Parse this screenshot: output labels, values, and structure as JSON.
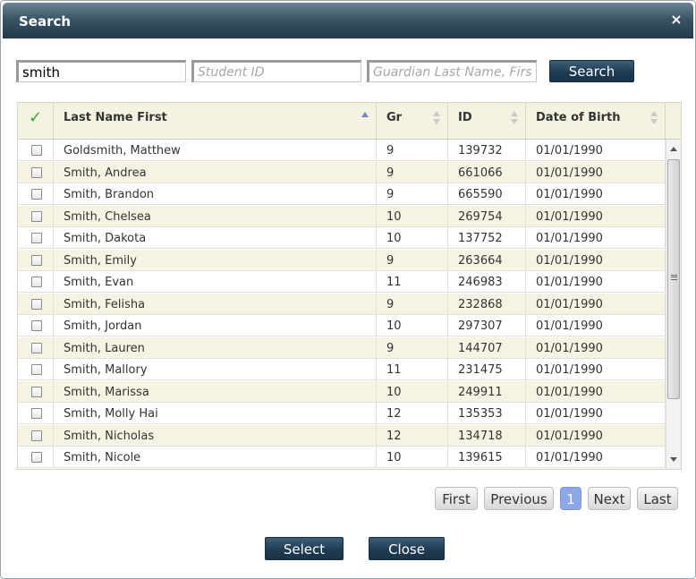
{
  "dialog": {
    "title": "Search",
    "close_glyph": "×"
  },
  "search": {
    "name_value": "smith",
    "student_id_placeholder": "Student ID",
    "guardian_placeholder": "Guardian Last Name, First",
    "button_label": "Search"
  },
  "grid": {
    "check_glyph": "✓",
    "columns": [
      "Last Name First",
      "Gr",
      "ID",
      "Date of Birth"
    ],
    "sorted_column": "Last Name First",
    "sort_direction": "ascending",
    "rows": [
      {
        "name": "Goldsmith, Matthew",
        "gr": "9",
        "id": "139732",
        "dob": "01/01/1990"
      },
      {
        "name": "Smith, Andrea",
        "gr": "9",
        "id": "661066",
        "dob": "01/01/1990"
      },
      {
        "name": "Smith, Brandon",
        "gr": "9",
        "id": "665590",
        "dob": "01/01/1990"
      },
      {
        "name": "Smith, Chelsea",
        "gr": "10",
        "id": "269754",
        "dob": "01/01/1990"
      },
      {
        "name": "Smith, Dakota",
        "gr": "10",
        "id": "137752",
        "dob": "01/01/1990"
      },
      {
        "name": "Smith, Emily",
        "gr": "9",
        "id": "263664",
        "dob": "01/01/1990"
      },
      {
        "name": "Smith, Evan",
        "gr": "11",
        "id": "246983",
        "dob": "01/01/1990"
      },
      {
        "name": "Smith, Felisha",
        "gr": "9",
        "id": "232868",
        "dob": "01/01/1990"
      },
      {
        "name": "Smith, Jordan",
        "gr": "10",
        "id": "297307",
        "dob": "01/01/1990"
      },
      {
        "name": "Smith, Lauren",
        "gr": "9",
        "id": "144707",
        "dob": "01/01/1990"
      },
      {
        "name": "Smith, Mallory",
        "gr": "11",
        "id": "231475",
        "dob": "01/01/1990"
      },
      {
        "name": "Smith, Marissa",
        "gr": "10",
        "id": "249911",
        "dob": "01/01/1990"
      },
      {
        "name": "Smith, Molly Hai",
        "gr": "12",
        "id": "135353",
        "dob": "01/01/1990"
      },
      {
        "name": "Smith, Nicholas",
        "gr": "12",
        "id": "134718",
        "dob": "01/01/1990"
      },
      {
        "name": "Smith, Nicole",
        "gr": "10",
        "id": "139615",
        "dob": "01/01/1990"
      }
    ]
  },
  "pager": {
    "first": "First",
    "previous": "Previous",
    "current": "1",
    "next": "Next",
    "last": "Last"
  },
  "actions": {
    "select": "Select",
    "close": "Close"
  },
  "colors": {
    "titlebar": "#2b4557",
    "accent_button": "#1f3c53",
    "row_alt": "#f6f3e2",
    "current_page": "#8da7e8",
    "check": "#35a535"
  }
}
